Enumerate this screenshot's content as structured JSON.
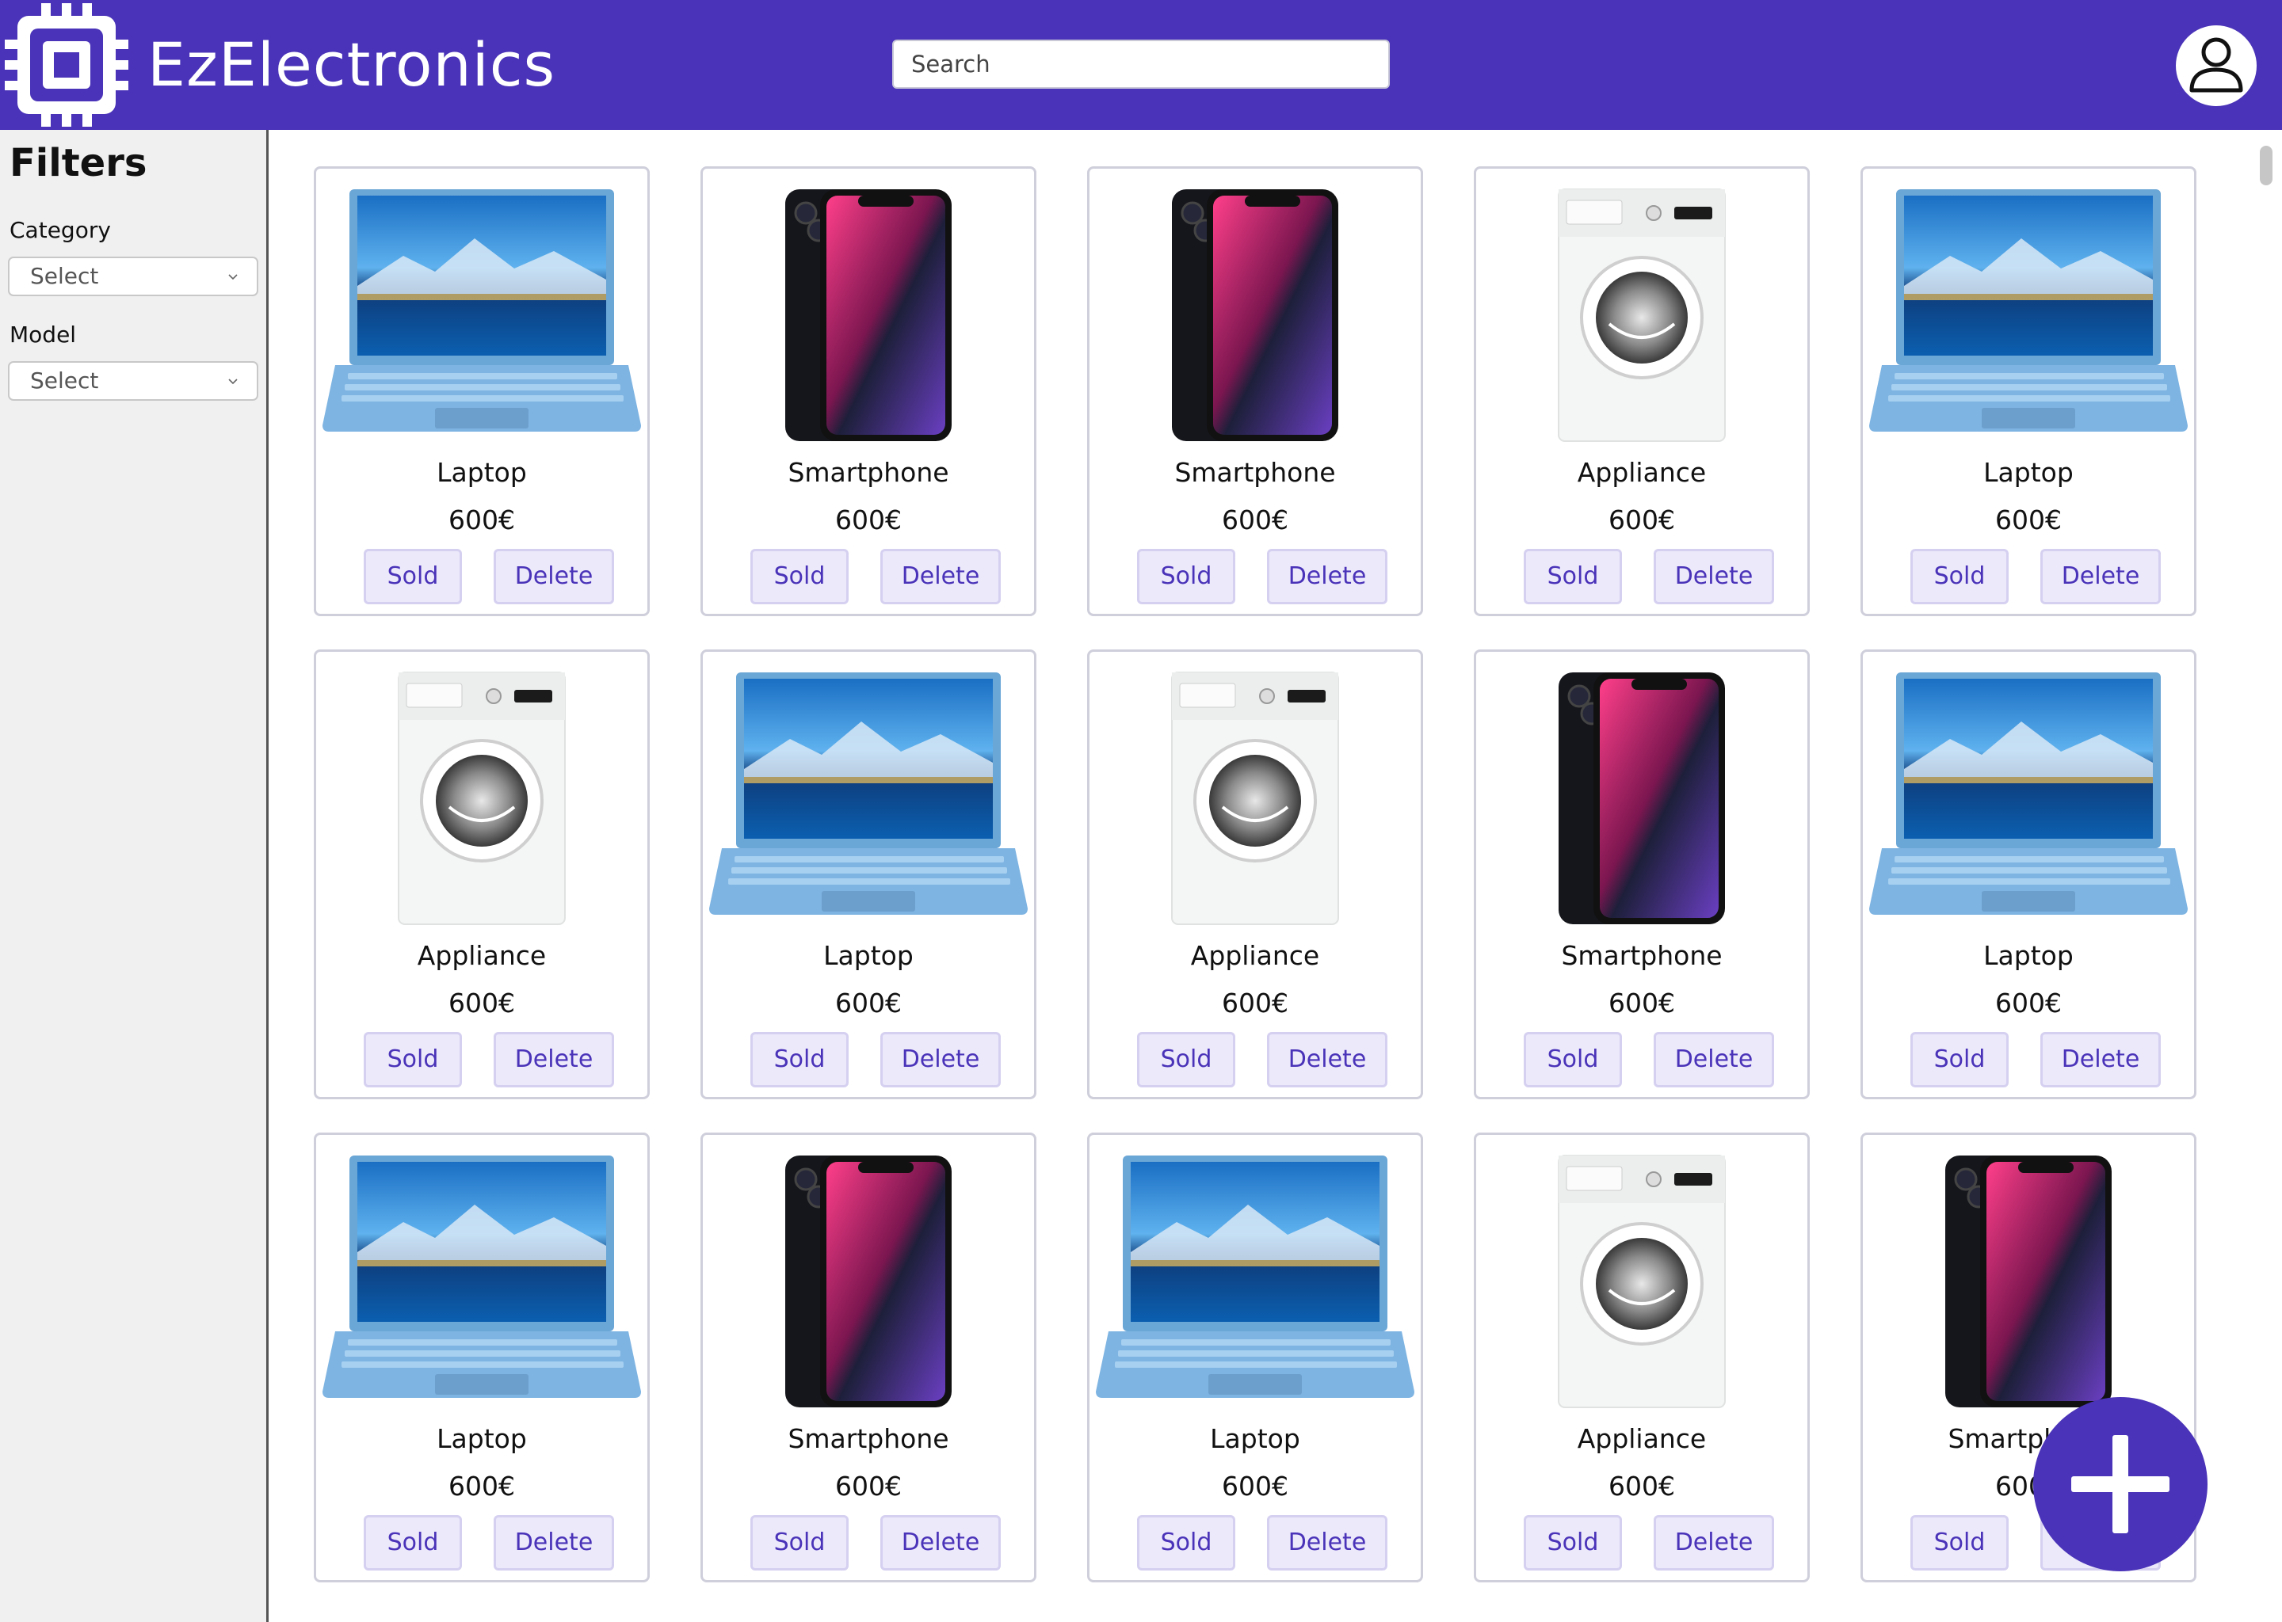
{
  "header": {
    "brand": "EzElectronics",
    "search_placeholder": "Search",
    "logo_icon": "chip-icon",
    "avatar_icon": "user-icon"
  },
  "sidebar": {
    "title": "Filters",
    "category_label": "Category",
    "category_value": "Select",
    "model_label": "Model",
    "model_value": "Select"
  },
  "buttons": {
    "sold": "Sold",
    "delete": "Delete"
  },
  "products": [
    {
      "name": "Laptop",
      "price": "600€",
      "kind": "laptop"
    },
    {
      "name": "Smartphone",
      "price": "600€",
      "kind": "smartphone"
    },
    {
      "name": "Smartphone",
      "price": "600€",
      "kind": "smartphone"
    },
    {
      "name": "Appliance",
      "price": "600€",
      "kind": "appliance"
    },
    {
      "name": "Laptop",
      "price": "600€",
      "kind": "laptop"
    },
    {
      "name": "Appliance",
      "price": "600€",
      "kind": "appliance"
    },
    {
      "name": "Laptop",
      "price": "600€",
      "kind": "laptop"
    },
    {
      "name": "Appliance",
      "price": "600€",
      "kind": "appliance"
    },
    {
      "name": "Smartphone",
      "price": "600€",
      "kind": "smartphone"
    },
    {
      "name": "Laptop",
      "price": "600€",
      "kind": "laptop"
    },
    {
      "name": "Laptop",
      "price": "600€",
      "kind": "laptop"
    },
    {
      "name": "Smartphone",
      "price": "600€",
      "kind": "smartphone"
    },
    {
      "name": "Laptop",
      "price": "600€",
      "kind": "laptop"
    },
    {
      "name": "Appliance",
      "price": "600€",
      "kind": "appliance"
    },
    {
      "name": "Smartphone",
      "price": "600€",
      "kind": "smartphone"
    }
  ],
  "fab_icon": "plus-icon",
  "colors": {
    "brand": "#4a33b8",
    "button_bg": "#ece9fb",
    "button_text": "#4a33b8"
  }
}
